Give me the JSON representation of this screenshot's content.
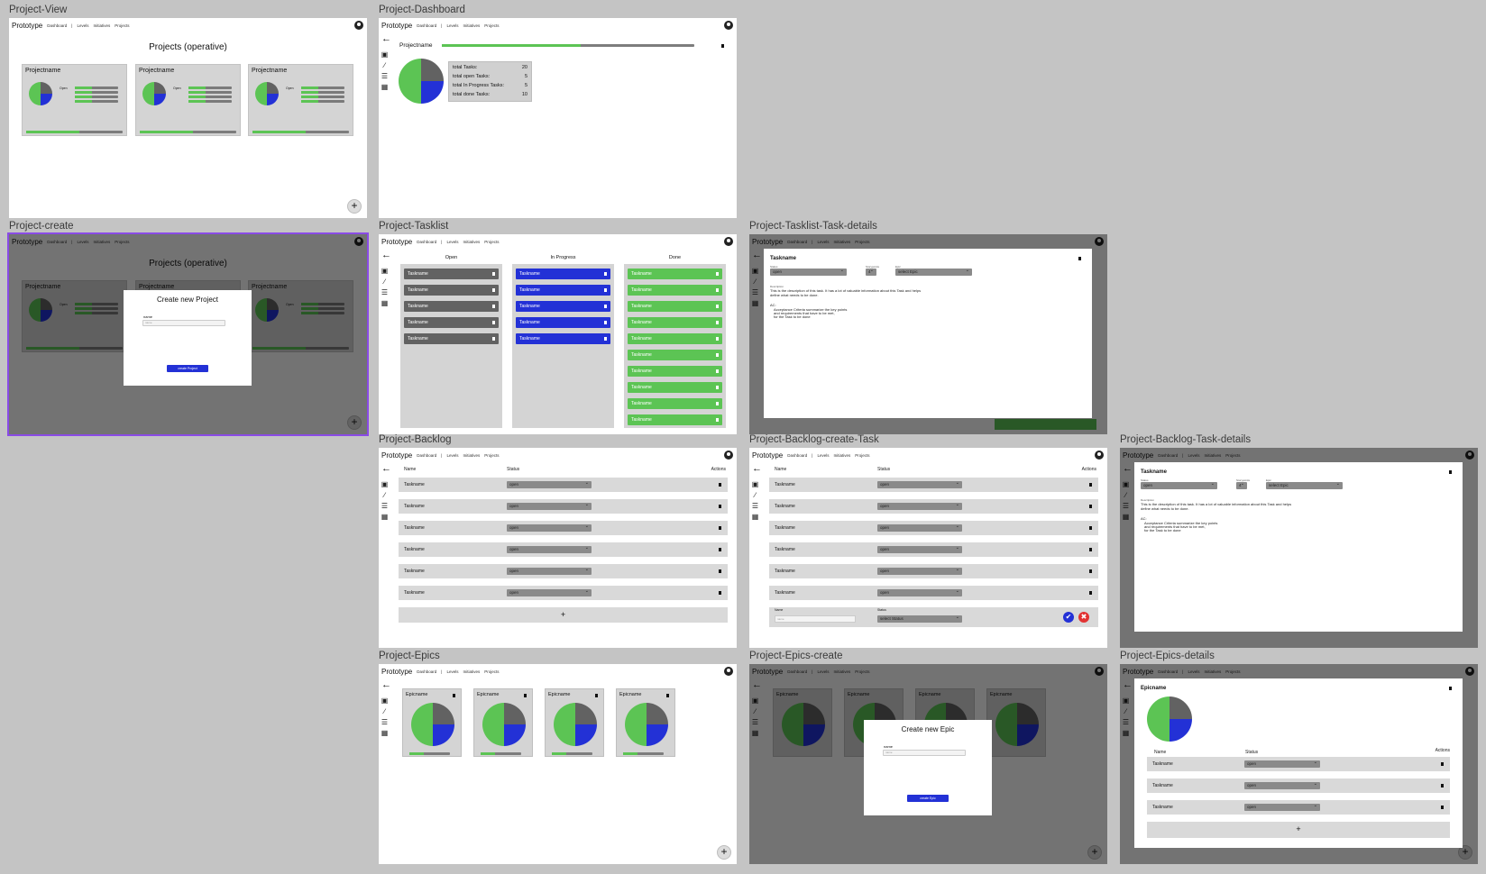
{
  "nav": {
    "brand": "Prototype",
    "dashboard": "Dashboard",
    "sep": "|",
    "levels": "Levels",
    "initiatives": "Initiatives",
    "projects": "Projects"
  },
  "frames": {
    "project_view": "Project-View",
    "project_dashboard": "Project-Dashboard",
    "project_create": "Project-create",
    "project_tasklist": "Project-Tasklist",
    "project_tasklist_task_details": "Project-Tasklist-Task-details",
    "project_backlog": "Project-Backlog",
    "project_backlog_create_task": "Project-Backlog-create-Task",
    "project_backlog_task_details": "Project-Backlog-Task-details",
    "project_epics": "Project-Epics",
    "project_epics_create": "Project-Epics-create",
    "project_epics_details": "Project-Epics-details"
  },
  "projects": {
    "title": "Projects (operative)",
    "card_name": "Projectname",
    "open_label": "Open",
    "add": "+"
  },
  "dashboard": {
    "project_name": "Projectname",
    "stats": [
      {
        "label": "total Tasks:",
        "value": "20"
      },
      {
        "label": "total open Tasks:",
        "value": "5"
      },
      {
        "label": "total In Progress Tasks:",
        "value": "5"
      },
      {
        "label": "total done Tasks:",
        "value": "10"
      }
    ]
  },
  "create_project": {
    "title": "Create new Project",
    "name_label": "name",
    "name_placeholder": "name",
    "button": "create Project"
  },
  "tasklist": {
    "open": "Open",
    "in_progress": "In Progress",
    "done": "Done",
    "task": "Taskname"
  },
  "task_details": {
    "title": "Taskname",
    "status_label": "Status",
    "status_value": "open",
    "sp_label": "Storypoints",
    "sp_value": "4",
    "epic_label": "Epic",
    "epic_value": "select Epic",
    "description_label": "Description",
    "description": "This is the description of this task. It has a lot of valuable information about this Task and helps define what needs to be done.",
    "ac_label": "AC:",
    "ac": [
      "Acceptance Criteria summarize the key points",
      "and requirements that have to be met,",
      "for the Task to be done"
    ]
  },
  "backlog": {
    "col_name": "Name",
    "col_status": "Status",
    "col_actions": "Actions",
    "task": "Taskname",
    "status": "open",
    "add": "+",
    "new_name_label": "Name",
    "new_name_placeholder": "name",
    "new_status_label": "Status",
    "new_status_value": "select Status",
    "confirm": "✔",
    "cancel": "✖"
  },
  "epics": {
    "card_name": "Epicname"
  },
  "create_epic": {
    "title": "Create new Epic",
    "name_label": "name",
    "name_placeholder": "name",
    "button": "create Epic"
  },
  "epic_details": {
    "title": "Epicname",
    "col_name": "Name",
    "col_status": "Status",
    "col_actions": "Actions",
    "task": "Taskname",
    "status": "open",
    "add": "+"
  },
  "colors": {
    "green": "#5cc454",
    "blue": "#2331d6",
    "grey": "#626262"
  },
  "progress": {
    "project_card": 0.55,
    "dashboard": 0.55,
    "epic_card": 0.35
  }
}
